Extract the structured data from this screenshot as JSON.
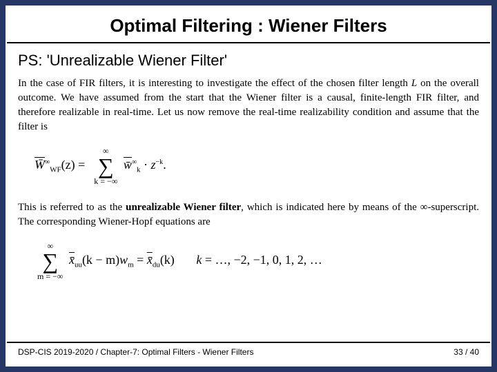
{
  "slide": {
    "title": "Optimal Filtering : Wiener Filters",
    "subtitle": "PS: 'Unrealizable Wiener Filter'",
    "paragraph1_prefix": "In the case of FIR filters, it is interesting to investigate the effect of the chosen filter length ",
    "paragraph1_L": "L",
    "paragraph1_suffix": " on the overall outcome. We have assumed from the start that the Wiener filter is a causal, finite-length FIR filter, and therefore realizable in real-time. Let us now remove the real-time realizability condition and assume that the filter is",
    "eq1": {
      "lhs": "W̄",
      "lhs_sub": "WF",
      "lhs_arg": "(z) = ",
      "sum_top": "∞",
      "sum_bot": "k = −∞",
      "wk": "w̄",
      "wk_sub": "k",
      "dot": "·",
      "z": "z",
      "zexp": "−k",
      "tail": "."
    },
    "paragraph2_a": "This is referred to as the ",
    "paragraph2_bold": "unrealizable Wiener filter",
    "paragraph2_b": ", which is indicated here by means of the ∞-superscript. The corresponding Wiener-Hopf equations are",
    "eq2": {
      "sum_top": "∞",
      "sum_bot": "m = −∞",
      "xuu": "x̄",
      "xuu_sub": "uu",
      "arg1": "(k − m)",
      "wm": "w",
      "wm_sub": "m",
      "eq": " = ",
      "xdu": "x̄",
      "xdu_sub": "du",
      "arg2": "(k)",
      "spacer": "     ",
      "kvar": "k",
      "klist": " = …, −2, −1, 0, 1, 2, …"
    }
  },
  "footer": {
    "left": "DSP-CIS 2019-2020 / Chapter-7: Optimal Filters - Wiener Filters",
    "right": "33 / 40"
  }
}
